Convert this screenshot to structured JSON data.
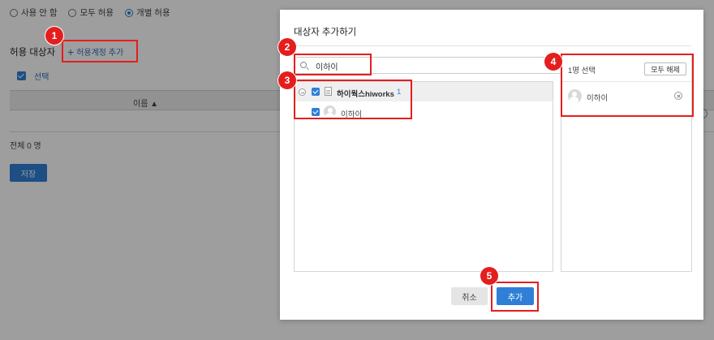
{
  "background": {
    "radio_options": [
      {
        "label": "사용 안 함",
        "selected": false
      },
      {
        "label": "모두 허용",
        "selected": false
      },
      {
        "label": "개별 허용",
        "selected": true
      }
    ],
    "target_title": "허용 대상자",
    "add_account_label": "허용계정 추가",
    "select_label": "선택",
    "column_name": "이름 ▲",
    "total_label": "전체 0 명",
    "save_label": "저장"
  },
  "modal": {
    "title": "대상자 추가하기",
    "search": {
      "value": "이하이",
      "icon": "search-icon"
    },
    "tree": {
      "group_name": "하이웍스hiworks",
      "group_count": "1",
      "member_name": "이하이"
    },
    "selection": {
      "count_label": "1명 선택",
      "clear_all_label": "모두 해제",
      "selected_name": "이하이"
    },
    "cancel_label": "취소",
    "add_label": "추가"
  },
  "annotations": {
    "markers": [
      "1",
      "2",
      "3",
      "4",
      "5"
    ],
    "color": "#e41e1e"
  },
  "colors": {
    "accent": "#2f7fd6",
    "highlight": "#e41e1e"
  }
}
